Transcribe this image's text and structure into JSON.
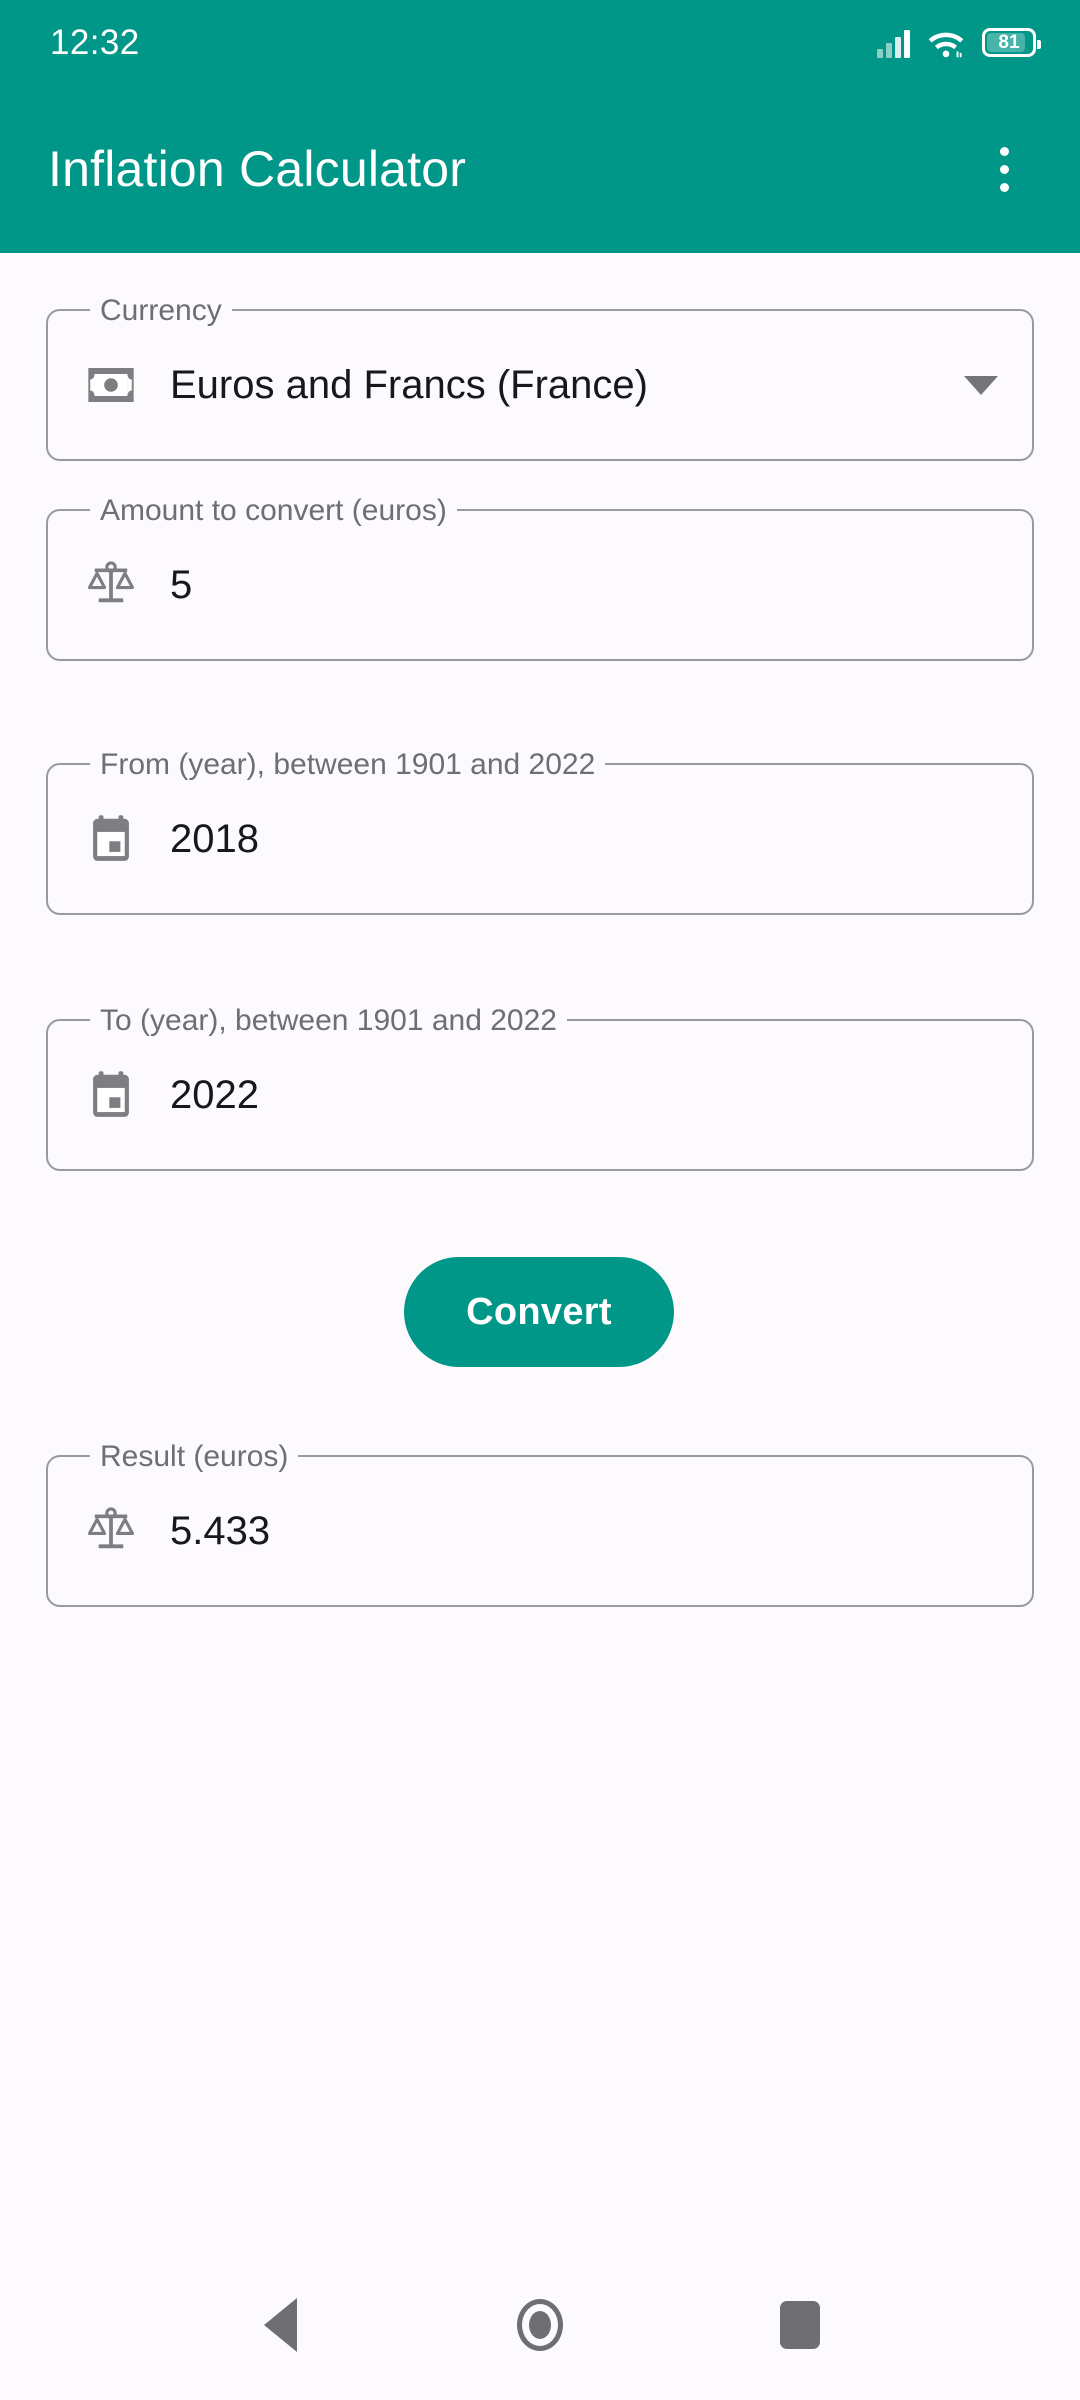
{
  "status_bar": {
    "time": "12:32",
    "battery_level": "81",
    "icons": [
      "signal-icon",
      "wifi-icon",
      "battery-icon"
    ]
  },
  "app_bar": {
    "title": "Inflation Calculator",
    "overflow_menu": "more-options",
    "background_color": "#009688"
  },
  "theme": {
    "accent": "#009688",
    "background": "#FCFAFD",
    "outline": "#9A9A9E",
    "label_text": "#6E6E73",
    "value_text": "#18181B"
  },
  "form": {
    "fields": [
      {
        "id": "currency",
        "label": "Currency",
        "value": "Euros and Francs (France)",
        "icon": "banknote-icon",
        "type": "dropdown"
      },
      {
        "id": "amount",
        "label": "Amount to convert (euros)",
        "value": "5",
        "icon": "scales-icon",
        "type": "text"
      },
      {
        "id": "from_year",
        "label": "From (year), between 1901 and 2022",
        "value": "2018",
        "icon": "calendar-icon",
        "type": "text"
      },
      {
        "id": "to_year",
        "label": "To (year), between 1901 and 2022",
        "value": "2022",
        "icon": "calendar-icon",
        "type": "text"
      },
      {
        "id": "result",
        "label": "Result (euros)",
        "value": "5.433",
        "icon": "scales-icon",
        "type": "readonly"
      }
    ],
    "convert_button": "Convert"
  },
  "nav_bar": {
    "back": "back-button",
    "home": "home-button",
    "recents": "recents-button"
  }
}
